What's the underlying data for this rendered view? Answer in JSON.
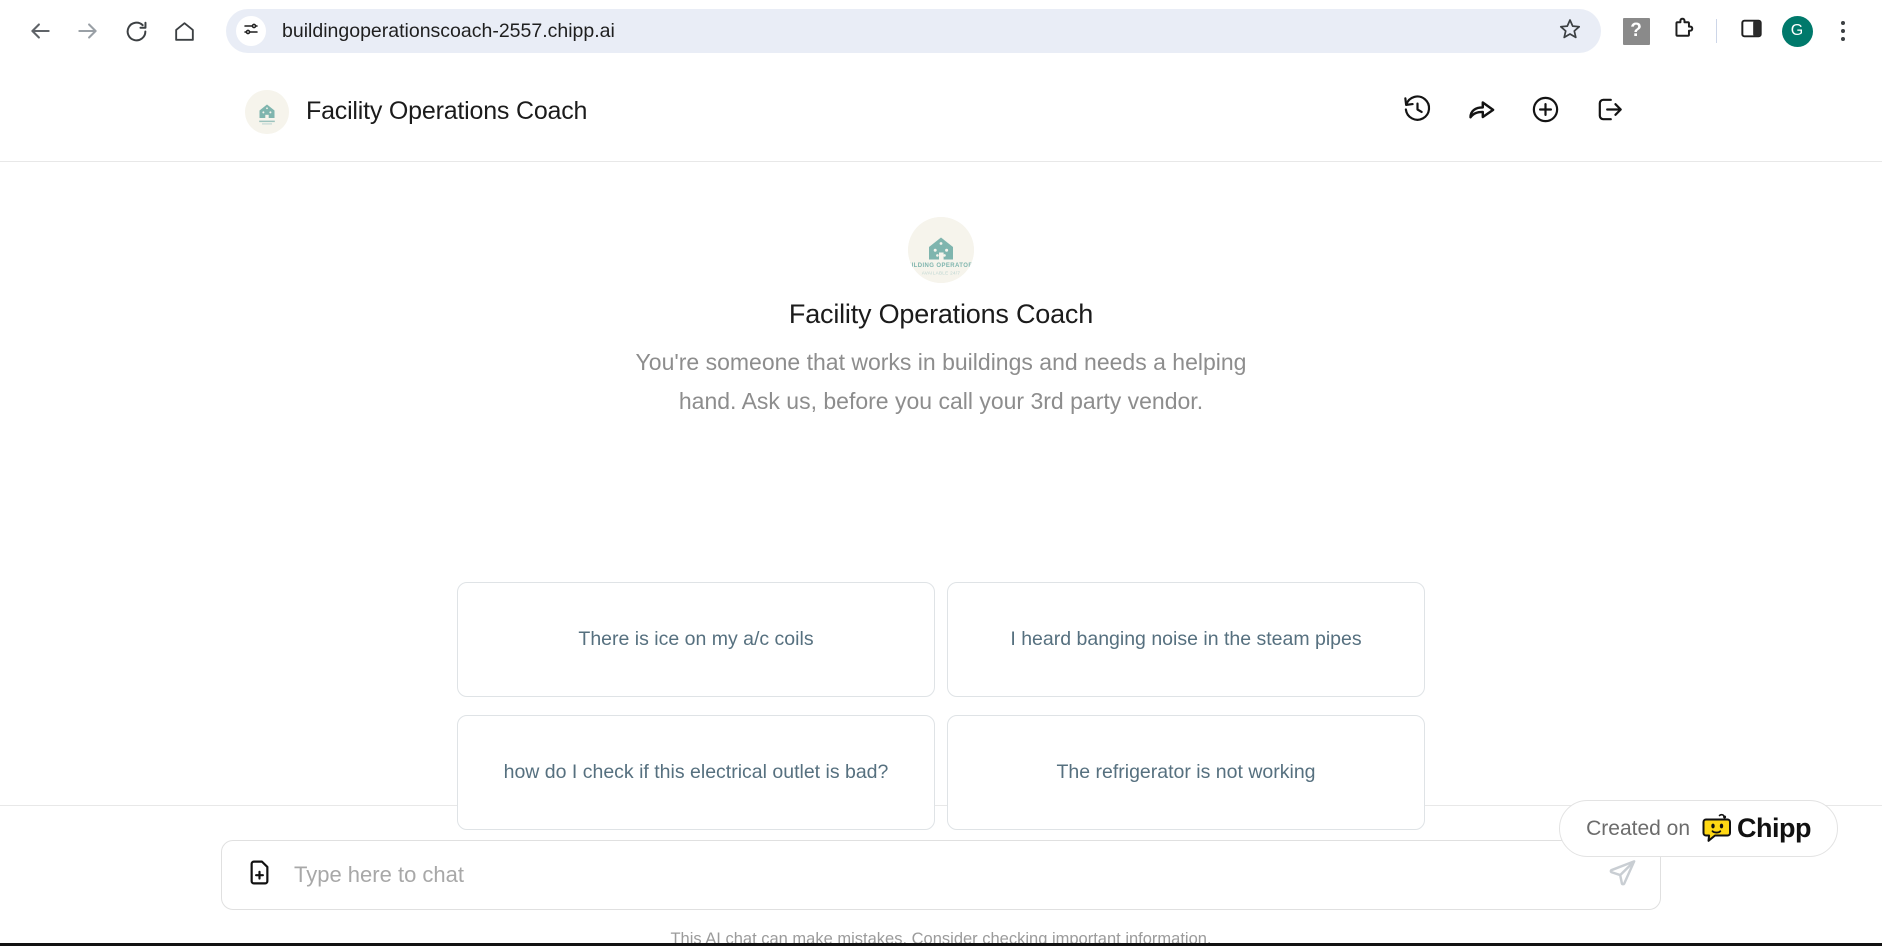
{
  "browser": {
    "back_icon": "back-arrow-icon",
    "forward_icon": "forward-arrow-icon",
    "reload_icon": "reload-icon",
    "home_icon": "home-icon",
    "site_settings_icon": "site-settings-sliders-icon",
    "url": "buildingoperationscoach-2557.chipp.ai",
    "bookmark_icon": "bookmark-star-icon",
    "help_icon": "help-question-icon",
    "help_glyph": "?",
    "extensions_icon": "extensions-puzzle-icon",
    "side_panel_icon": "side-panel-icon",
    "profile_initial": "G",
    "menu_icon": "kebab-menu-icon",
    "accent": "#00796B",
    "omnibox_bg": "#E9EDF6"
  },
  "app_header": {
    "title": "Facility Operations Coach",
    "logo_alt": "facility-operations-coach-logo",
    "actions": [
      {
        "name": "history-icon",
        "label": "History"
      },
      {
        "name": "share-icon",
        "label": "Share"
      },
      {
        "name": "new-chat-icon",
        "label": "New chat"
      },
      {
        "name": "logout-icon",
        "label": "Log out"
      }
    ]
  },
  "welcome": {
    "logo_alt": "building-operator-badge-logo",
    "logo_text_primary": "BUILDING OPERATOR C",
    "logo_text_secondary": "AVAILABLE 24/7",
    "title": "Facility Operations Coach",
    "description": "You're someone that works in buildings and needs a helping hand. Ask us, before you call your 3rd party vendor.",
    "logo_bg": "#F6F4EC",
    "logo_fg": "#7FB5AE"
  },
  "suggestions": [
    {
      "text": "There is ice on my a/c coils"
    },
    {
      "text": "I heard banging noise in the steam pipes"
    },
    {
      "text": "how do I check if this electrical outlet is bad?"
    },
    {
      "text": "The refrigerator is not working"
    }
  ],
  "chipp_badge": {
    "prefix": "Created on",
    "brand": "Chipp",
    "mascot_icon": "chipp-mascot-icon",
    "mascot_color": "#FFD814"
  },
  "composer": {
    "attach_icon": "attach-file-icon",
    "placeholder": "Type here to chat",
    "value": "",
    "send_icon": "send-paper-plane-icon"
  },
  "footer": {
    "disclaimer": "This AI chat can make mistakes. Consider checking important information."
  }
}
